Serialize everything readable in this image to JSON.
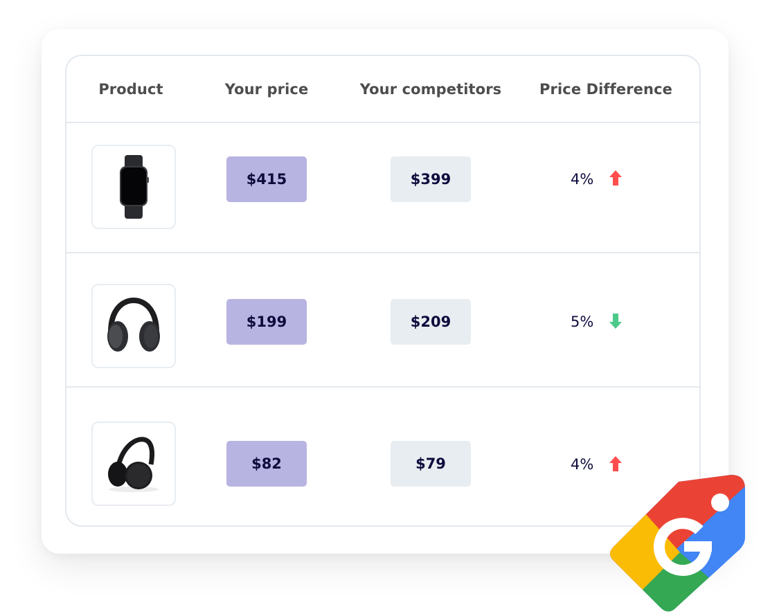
{
  "table": {
    "headers": {
      "product": "Product",
      "your_price": "Your price",
      "competitors": "Your competitors",
      "price_difference": "Price Difference"
    },
    "rows": [
      {
        "product_icon": "smartwatch-image",
        "your_price": "$415",
        "competitor_price": "$399",
        "difference": "4%",
        "trend": "up",
        "trend_icon": "arrow-up-icon"
      },
      {
        "product_icon": "over-ear-headphones-image",
        "your_price": "$199",
        "competitor_price": "$209",
        "difference": "5%",
        "trend": "down",
        "trend_icon": "arrow-down-icon"
      },
      {
        "product_icon": "wireless-headphones-image",
        "your_price": "$82",
        "competitor_price": "$79",
        "difference": "4%",
        "trend": "up",
        "trend_icon": "arrow-up-icon"
      }
    ]
  },
  "colors": {
    "your_price_bg": "#b8b4e1",
    "competitor_price_bg": "#e8edf1",
    "price_text": "#0e0c3d",
    "up_arrow": "#ff4d4d",
    "down_arrow": "#4cc98a",
    "google_red": "#ea4335",
    "google_blue": "#4285f4",
    "google_yellow": "#fbbc05",
    "google_green": "#34a853"
  },
  "logo": {
    "icon": "google-shopping-tag-icon"
  }
}
